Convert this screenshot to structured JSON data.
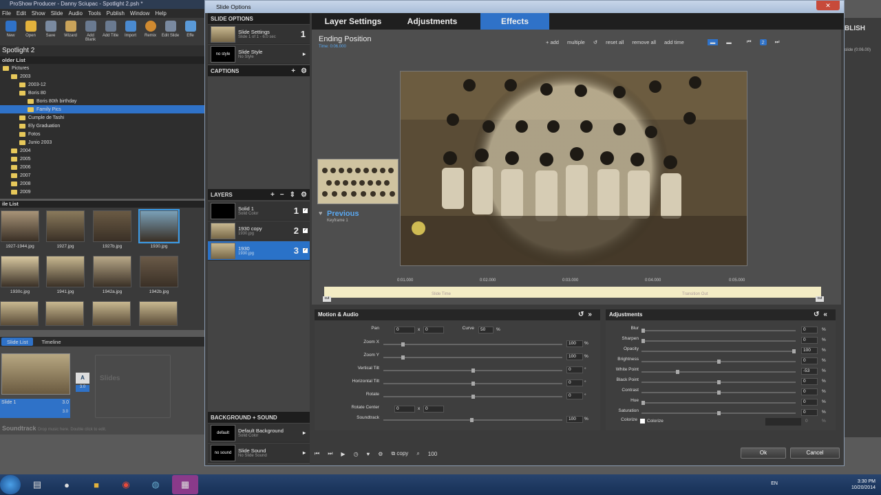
{
  "app": {
    "title": "ProShow Producer - Danny Sciupac - Spotlight 2.psh *",
    "menu": [
      "File",
      "Edit",
      "Show",
      "Slide",
      "Audio",
      "Tools",
      "Publish",
      "Window",
      "Help"
    ],
    "toolbar": [
      "New",
      "Open",
      "Save",
      "Wizard",
      "Add Blank",
      "Add Title",
      "Import",
      "Remix",
      "Edit Slide",
      "Effe"
    ],
    "project_name": "Spotlight 2",
    "folder_list_label": "older List",
    "folders": [
      {
        "label": "Pictures",
        "level": 0
      },
      {
        "label": "2003",
        "level": 1
      },
      {
        "label": "2003-12",
        "level": 2
      },
      {
        "label": "Boris 80",
        "level": 2
      },
      {
        "label": "Boris 80th birthday",
        "level": 3
      },
      {
        "label": "Family Pics",
        "level": 3,
        "selected": true
      },
      {
        "label": "Cumple de Tashi",
        "level": 2
      },
      {
        "label": "Ely Graduation",
        "level": 2
      },
      {
        "label": "Fotos",
        "level": 2
      },
      {
        "label": "Junio 2003",
        "level": 2
      },
      {
        "label": "2004",
        "level": 1
      },
      {
        "label": "2005",
        "level": 1
      },
      {
        "label": "2006",
        "level": 1
      },
      {
        "label": "2007",
        "level": 1
      },
      {
        "label": "2008",
        "level": 1
      },
      {
        "label": "2009",
        "level": 1
      }
    ],
    "file_list_label": "ile List",
    "files": [
      "1927-1944.jpg",
      "1927.jpg",
      "1927b.jpg",
      "1930.jpg",
      "1930c.jpg",
      "1941.jpg",
      "1942a.jpg",
      "1942b.jpg"
    ],
    "bottom_tabs": [
      "Slide List",
      "Timeline"
    ],
    "slide_name": "Slide 1",
    "slide_time": "3.0",
    "slides_placeholder": "Slides",
    "transition_time": "3.0",
    "soundtrack_label": "Soundtrack",
    "soundtrack_hint": "Drop music here. Double click to edit.",
    "publish_label": "BLISH",
    "right_time": "slide (0:06.00)"
  },
  "taskbar": {
    "lang": "EN",
    "time": "3:30 PM",
    "date": "10/20/2014"
  },
  "dialog": {
    "title": "Slide Options",
    "close": "✕",
    "slide_options_label": "SLIDE OPTIONS",
    "slide_settings": {
      "title": "Slide Settings",
      "sub": "Slide 1 of 1 - 6.0 sec",
      "num": "1"
    },
    "slide_style": {
      "title": "Slide Style",
      "sub": "No Style",
      "box": "no style"
    },
    "captions_label": "CAPTIONS",
    "layers_label": "LAYERS",
    "layers": [
      {
        "title": "Solid 1",
        "sub": "Solid Color",
        "num": "1"
      },
      {
        "title": "1930 copy",
        "sub": "1930.jpg",
        "num": "2"
      },
      {
        "title": "1930",
        "sub": "1930.jpg",
        "num": "3",
        "selected": true
      }
    ],
    "bg_sound_label": "BACKGROUND + SOUND",
    "background": {
      "title": "Default Background",
      "sub": "Solid Color",
      "box": "default"
    },
    "sound": {
      "title": "Slide Sound",
      "sub": "No Slide Sound",
      "box": "no sound"
    },
    "tabs": [
      "Layer Settings",
      "Adjustments",
      "Effects"
    ],
    "active_tab": "Effects",
    "editor": {
      "title": "Ending Position",
      "time": "Time: 0:06.000",
      "toolbar": [
        "+ add",
        "multiple",
        "reset all",
        "remove all",
        "add time"
      ],
      "previous": "Previous",
      "keyframe": "Keyframe 1",
      "ticks": [
        "0:01.000",
        "0:02.000",
        "0:03.000",
        "0:04.000",
        "0:05.000"
      ],
      "slide_time": "Slide Time",
      "transition_out": "Transition Out",
      "start_marker": "cut",
      "end_marker": "cut"
    },
    "motion": {
      "title": "Motion & Audio",
      "pan_label": "Pan",
      "pan_x": "0",
      "pan_y": "0",
      "curve_label": "Curve",
      "curve": "50",
      "rows": [
        {
          "label": "Zoom X",
          "value": "100",
          "unit": "%",
          "pos": 0.1
        },
        {
          "label": "Zoom Y",
          "value": "100",
          "unit": "%",
          "pos": 0.1
        },
        {
          "label": "Vertical Tilt",
          "value": "0",
          "unit": "°",
          "pos": 0.5
        },
        {
          "label": "Horizontal Tilt",
          "value": "0",
          "unit": "°",
          "pos": 0.5
        },
        {
          "label": "Rotate",
          "value": "0",
          "unit": "°",
          "pos": 0.5
        }
      ],
      "rotate_center_label": "Rotate Center",
      "rc_x": "0",
      "rc_y": "0",
      "soundtrack_label": "Soundtrack",
      "soundtrack_value": "100",
      "soundtrack_unit": "%"
    },
    "adjustments": {
      "title": "Adjustments",
      "rows": [
        {
          "label": "Blur",
          "value": "0",
          "unit": "%",
          "pos": 0.0
        },
        {
          "label": "Sharpen",
          "value": "0",
          "unit": "%",
          "pos": 0.0
        },
        {
          "label": "Opacity",
          "value": "100",
          "unit": "%",
          "pos": 1.0
        },
        {
          "label": "Brightness",
          "value": "0",
          "unit": "%",
          "pos": 0.5
        },
        {
          "label": "White Point",
          "value": "-53",
          "unit": "%",
          "pos": 0.23
        },
        {
          "label": "Black Point",
          "value": "0",
          "unit": "%",
          "pos": 0.5
        },
        {
          "label": "Contrast",
          "value": "0",
          "unit": "%",
          "pos": 0.5
        },
        {
          "label": "Hue",
          "value": "0",
          "unit": "%",
          "pos": 0.0
        },
        {
          "label": "Saturation",
          "value": "0",
          "unit": "%",
          "pos": 0.5
        }
      ],
      "colorize_label": "Colorize",
      "colorize_check": "Colorize",
      "colorize_value": "0",
      "colorize_unit": "%"
    },
    "bottom": {
      "copy": "copy",
      "zoom": "100",
      "ok": "Ok",
      "cancel": "Cancel"
    }
  }
}
